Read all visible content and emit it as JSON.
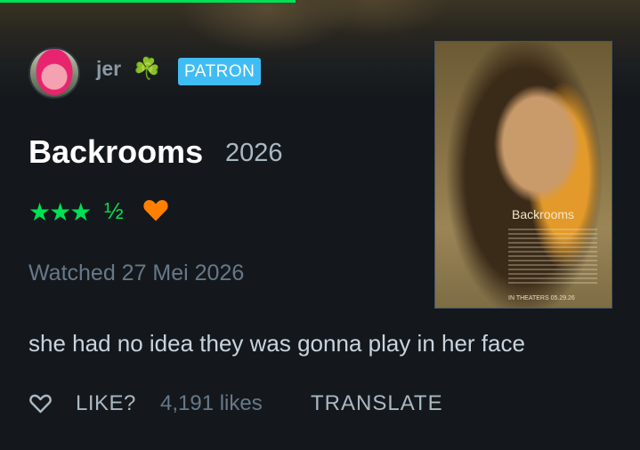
{
  "user": {
    "name": "jer",
    "emoji": "☘️",
    "badge": "PATRON"
  },
  "film": {
    "title": "Backrooms",
    "year": "2026",
    "poster": {
      "title": "Backrooms",
      "date_line": "IN THEATERS 05.29.26"
    }
  },
  "rating": {
    "stars": 3.5,
    "full_stars": "★★★",
    "half_star": "½",
    "liked": true
  },
  "watched": "Watched 27 Mei 2026",
  "review": "she had no idea they was gonna play in her face",
  "actions": {
    "like_label": "LIKE?",
    "likes_count": "4,191 likes",
    "translate_label": "TRANSLATE"
  },
  "colors": {
    "accent_green": "#00e054",
    "heart_orange": "#ff8000",
    "patron_blue": "#40bcf4",
    "background": "#14181c"
  },
  "icons": {
    "liked": "heart-icon",
    "like_action": "heart-outline-icon",
    "emoji": "clover-icon"
  }
}
